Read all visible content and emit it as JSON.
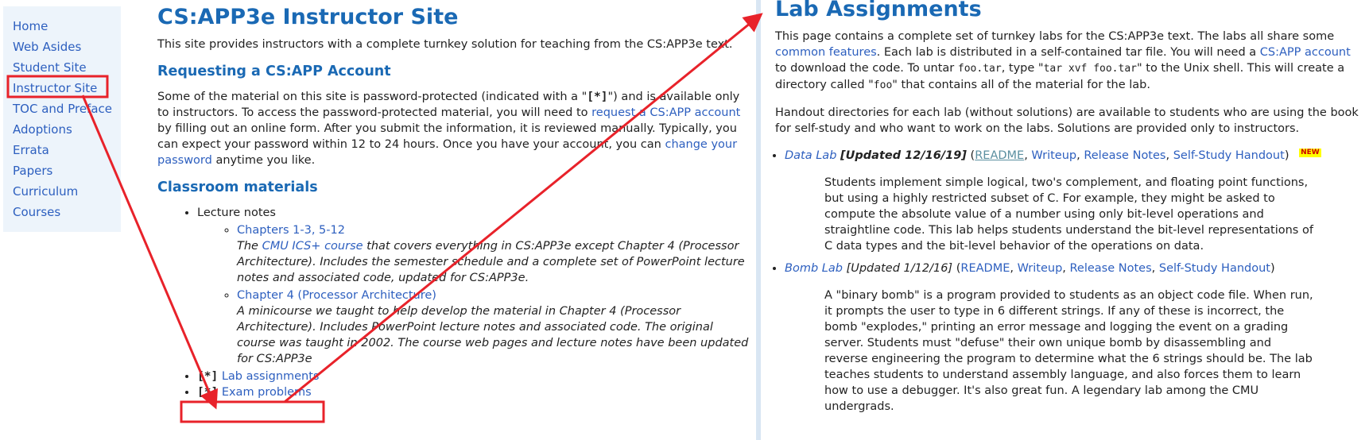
{
  "sidebar": {
    "items": [
      {
        "label": "Home"
      },
      {
        "label": "Web Asides"
      },
      {
        "label": "Student Site"
      },
      {
        "label": "Instructor Site"
      },
      {
        "label": "TOC and Preface"
      },
      {
        "label": "Adoptions"
      },
      {
        "label": "Errata"
      },
      {
        "label": "Papers"
      },
      {
        "label": "Curriculum"
      },
      {
        "label": "Courses"
      }
    ]
  },
  "main": {
    "title": "CS:APP3e Instructor Site",
    "intro": "This site provides instructors with a complete turnkey solution for teaching from the CS:APP3e text.",
    "account_heading": "Requesting a CS:APP Account",
    "account_p1": "Some of the material on this site is password-protected (indicated with a \"",
    "bracket": "[*]",
    "account_p2": "\") and is available only to instructors. To access the password-protected material, you will need to ",
    "request_link": "request a CS:APP account",
    "account_p3": " by filling out an online form. After you submit the information, it is reviewed manually. Typically, you can expect your password within 12 to 24 hours. Once you have your account, you can ",
    "change_pw_link": "change your password",
    "account_p4": " anytime you like.",
    "classroom_heading": "Classroom materials",
    "lecture_notes": "Lecture notes",
    "ch_link_1": "Chapters 1-3, 5-12",
    "ch_desc_1a": "The ",
    "cmu_link": "CMU ICS+ course",
    "ch_desc_1b": " that covers everything in CS:APP3e except Chapter 4 (Processor Architecture). Includes the semester schedule and a complete set of PowerPoint lecture notes and associated code, updated for CS:APP3e.",
    "ch_link_2": "Chapter 4 (Processor Architecture)",
    "ch_desc_2": "A minicourse we taught to help develop the material in Chapter 4 (Processor Architecture). Includes PowerPoint lecture notes and associated code. The original course was taught in 2002. The course web pages and lecture notes have been updated for CS:APP3e",
    "lab_link": "Lab assignments",
    "exam_link": "Exam problems"
  },
  "right": {
    "title": "Lab Assignments",
    "p1a": "This page contains a complete set of turnkey labs for the CS:APP3e text. The labs all share some ",
    "common_link": "common features",
    "p1b": ". Each lab is distributed in a self-contained tar file. You will need a ",
    "csapp_link": "CS:APP account",
    "p1c": " to download the code. To untar ",
    "foo_tar": "foo.tar",
    "p1d": ", type \"",
    "tar_cmd": "tar xvf foo.tar",
    "p1e": "\" to the Unix shell. This will create a directory called \"",
    "foo": "foo",
    "p1f": "\" that contains all of the material for the lab.",
    "p2": "Handout directories for each lab (without solutions) are available to students who are using the book for self-study and who want to work on the labs. Solutions are provided only to instructors.",
    "labs": [
      {
        "name": "Data Lab",
        "updated": "[Updated 12/16/19]",
        "readme": "README",
        "writeup": "Writeup",
        "release": "Release Notes",
        "handout": "Self-Study Handout",
        "badge": "NEW",
        "desc": "Students implement simple logical, two's complement, and floating point functions, but using a highly restricted subset of C. For example, they might be asked to compute the absolute value of a number using only bit-level operations and straightline code. This lab helps students understand the bit-level representations of C data types and the bit-level behavior of the operations on data."
      },
      {
        "name": "Bomb Lab",
        "updated": "[Updated 1/12/16]",
        "readme": "README",
        "writeup": "Writeup",
        "release": "Release Notes",
        "handout": "Self-Study Handout",
        "desc": "A \"binary bomb\" is a program provided to students as an object code file. When run, it prompts the user to type in 6 different strings. If any of these is incorrect, the bomb \"explodes,\" printing an error message and logging the event on a grading server. Students must \"defuse\" their own unique bomb by disassembling and reverse engineering the program to determine what the 6 strings should be. The lab teaches students to understand assembly language, and also forces them to learn how to use a debugger. It's also great fun. A legendary lab among the CMU undergrads."
      }
    ]
  },
  "annotation": {
    "color": "#e8222a"
  }
}
